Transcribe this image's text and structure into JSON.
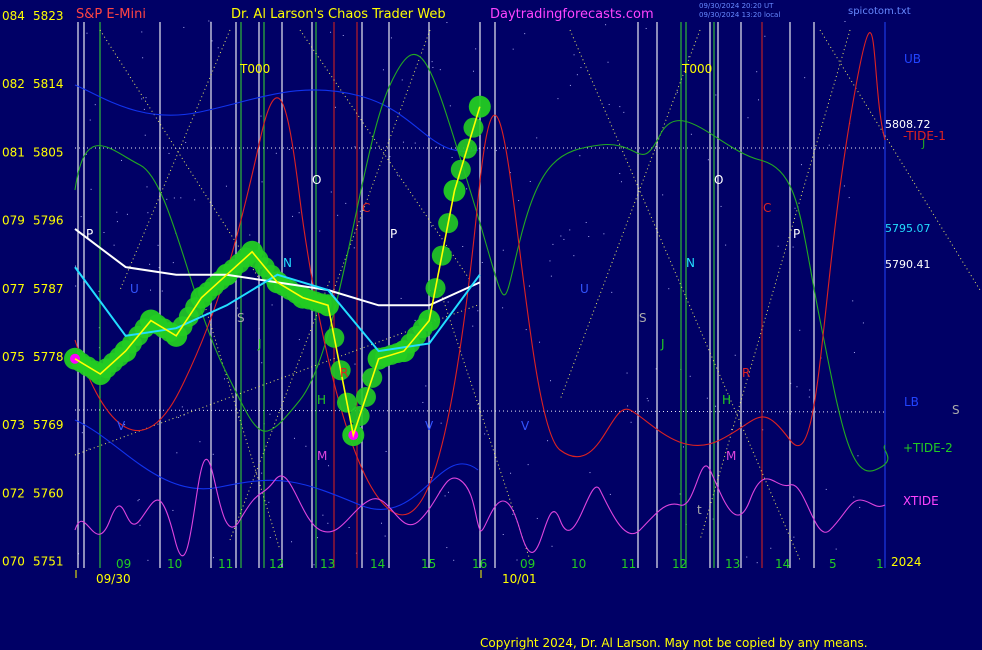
{
  "header": {
    "instrument": "S&P E-Mini",
    "title": "Dr. Al Larson's Chaos Trader Web",
    "site": "Daytradingforecasts.com",
    "stamp1": "09/30/2024 20:20 UT",
    "stamp2": "09/30/2024 13:20 local",
    "file": "spicotom.txt"
  },
  "footer": {
    "copyright": "Copyright 2024, Dr. Al Larson. May not be copied by any means."
  },
  "colors": {
    "background": "#000066",
    "price_bars": "#ffff00",
    "price_glow": "#22cc22",
    "glow_peak": "#ff00ff",
    "white_ma": "#ffffff",
    "cyan_ma": "#22ddff",
    "tide1": "#dd2222",
    "tide2": "#22cc22",
    "xtide": "#dd44dd",
    "ub_lb": "#1133ee",
    "axis_text": "#ffff00",
    "date_text": "#ffff00",
    "hour_text": "#22cc22"
  },
  "chart_data": {
    "type": "line",
    "y_left_labels": [
      {
        "a": "084",
        "b": "5823"
      },
      {
        "a": "082",
        "b": "5814"
      },
      {
        "a": "081",
        "b": "5805"
      },
      {
        "a": "079",
        "b": "5796"
      },
      {
        "a": "077",
        "b": "5787"
      },
      {
        "a": "075",
        "b": "5778"
      },
      {
        "a": "073",
        "b": "5769"
      },
      {
        "a": "072",
        "b": "5760"
      },
      {
        "a": "070",
        "b": "5751"
      }
    ],
    "ylim": [
      5751,
      5823
    ],
    "hour_ticks": [
      "09",
      "10",
      "11",
      "12",
      "13",
      "14",
      "15",
      "16",
      "09",
      "10",
      "11",
      "12",
      "13",
      "14",
      "5",
      "1"
    ],
    "date_labels": [
      "09/30",
      "10/01"
    ],
    "year_label": "2024",
    "right_labels": {
      "ub": "UB",
      "lb": "LB",
      "s": "S",
      "tide1": "-TIDE-1",
      "j": "J",
      "tide2": "+TIDE-2",
      "xtide": "XTIDE",
      "price_a": "5808.72",
      "price_b": "5795.07",
      "price_c": "5790.41"
    },
    "series": [
      {
        "name": "S&P E-Mini price",
        "x": [
          0,
          0.5,
          1,
          1.5,
          2,
          2.5,
          3,
          3.5,
          4,
          4.5,
          5,
          5.5,
          6,
          6.5,
          7,
          7.5,
          8
        ],
        "values": [
          5778,
          5776,
          5779,
          5783,
          5781,
          5786,
          5789,
          5792,
          5788,
          5786,
          5785,
          5768,
          5778,
          5779,
          5783,
          5800,
          5811
        ]
      },
      {
        "name": "White MA",
        "x": [
          0,
          1,
          2,
          3,
          4,
          5,
          6,
          7,
          8
        ],
        "values": [
          5795,
          5790,
          5789,
          5789,
          5788,
          5787,
          5785,
          5785,
          5788
        ]
      },
      {
        "name": "Cyan MA",
        "x": [
          0,
          1,
          2,
          3,
          4,
          5,
          6,
          7,
          8
        ],
        "values": [
          5790,
          5781,
          5782,
          5785,
          5789,
          5787,
          5779,
          5780,
          5789
        ]
      }
    ],
    "annotations": [
      {
        "text": "T000"
      },
      {
        "text": "T000"
      },
      {
        "text": "O"
      },
      {
        "text": "O"
      },
      {
        "text": "C"
      },
      {
        "text": "C"
      },
      {
        "text": "P"
      },
      {
        "text": "P"
      },
      {
        "text": "P"
      },
      {
        "text": "N"
      },
      {
        "text": "N"
      },
      {
        "text": "S"
      },
      {
        "text": "S"
      },
      {
        "text": "J"
      },
      {
        "text": "J"
      },
      {
        "text": "R"
      },
      {
        "text": "R"
      },
      {
        "text": "H"
      },
      {
        "text": "H"
      },
      {
        "text": "M"
      },
      {
        "text": "M"
      },
      {
        "text": "V"
      },
      {
        "text": "V"
      },
      {
        "text": "V"
      },
      {
        "text": "U"
      },
      {
        "text": "U"
      },
      {
        "text": "t"
      }
    ]
  }
}
